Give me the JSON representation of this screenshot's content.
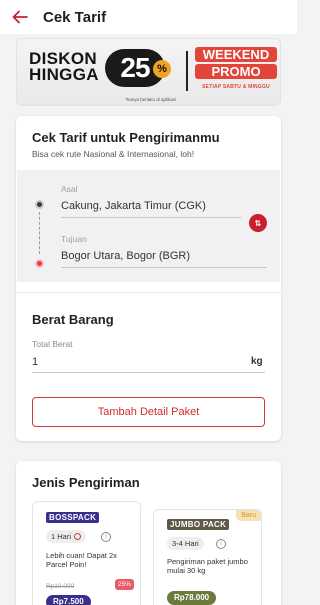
{
  "header": {
    "title": "Cek Tarif"
  },
  "banner": {
    "line1": "DISKON",
    "line2": "HINGGA",
    "percent": "25",
    "percent_sign": "%",
    "weekend_line1": "WEEKEND",
    "weekend_line2": "PROMO",
    "weekend_sub": "SETIAP SABTU & MINGGU",
    "footnote": "*hanya berlaku di aplikasi"
  },
  "tarif": {
    "title": "Cek Tarif untuk Pengirimanmu",
    "subtitle": "Bisa cek rute Nasional & Internasional, loh!",
    "origin_label": "Asal",
    "origin_value": "Cakung, Jakarta Timur (CGK)",
    "dest_label": "Tujuan",
    "dest_value": "Bogor Utara, Bogor (BGR)",
    "swap_icon": "⇅",
    "weight_title": "Berat Barang",
    "weight_label": "Total Berat",
    "weight_value": "1",
    "weight_unit": "kg",
    "detail_button": "Tambah Detail Paket"
  },
  "jenis": {
    "title": "Jenis Pengiriman",
    "packages": [
      {
        "logo": "BOSSPACK",
        "duration": "1 Hari",
        "desc": "Lebih cuan! Dapat 2x Parcel Poin!",
        "original_price": "Rp10.000",
        "discount": "25%",
        "price": "Rp7.500",
        "logo_color": "#3a2f8f",
        "price_color": "#3a2f8f"
      },
      {
        "logo": "JUMBO PACK",
        "new_badge": "Baru",
        "duration": "3-4 Hari",
        "desc": "Pengiriman paket jumbo mulai 30 kg",
        "price": "Rp78.000",
        "logo_color": "#6b5a2e",
        "price_color": "#6b7a3e"
      }
    ]
  },
  "colors": {
    "brand_red": "#c8202f",
    "background": "#f3f3f5"
  }
}
